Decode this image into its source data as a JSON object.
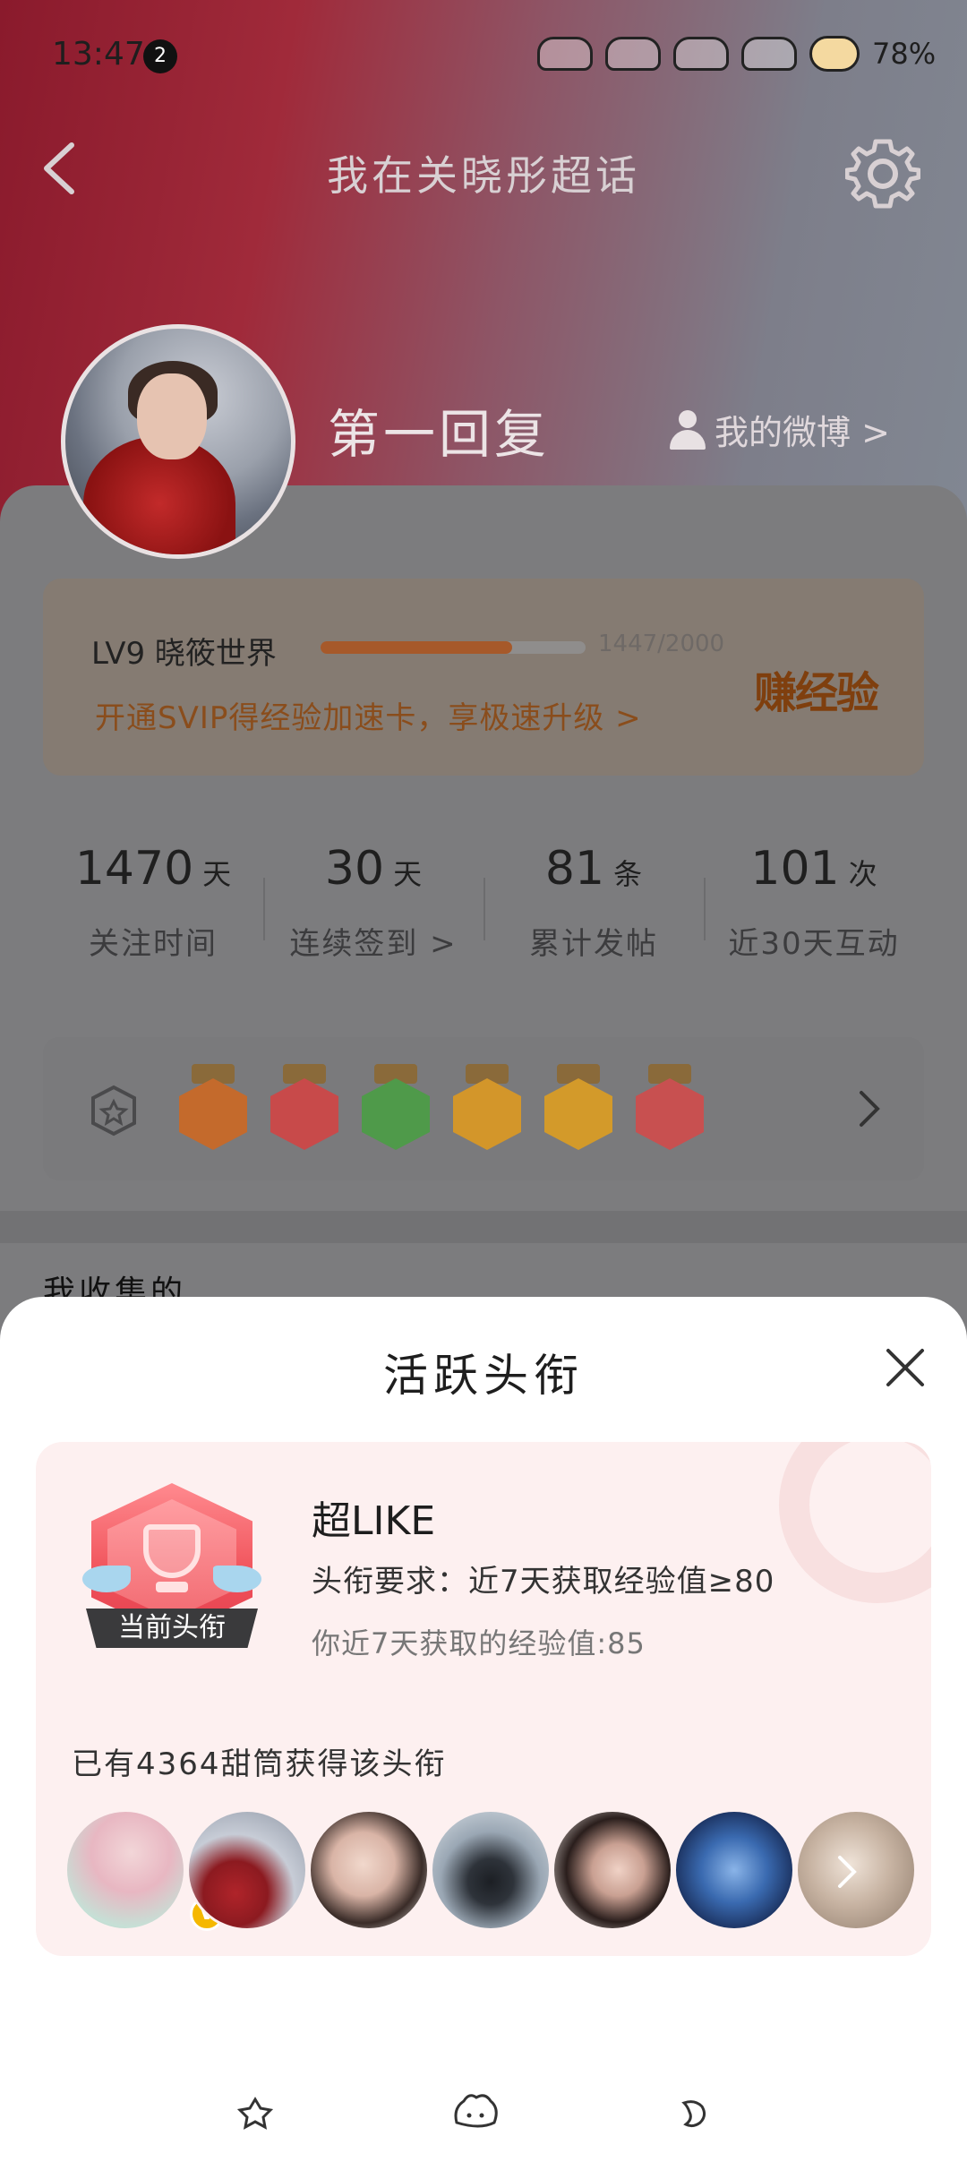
{
  "status_bar": {
    "time": "13:47",
    "notification_count": "2",
    "battery": "78%"
  },
  "nav": {
    "title": "我在关晓彤超话"
  },
  "profile": {
    "username": "第一回复",
    "my_weibo_label": "我的微博 >"
  },
  "level": {
    "label": "LV9 晓筱世界",
    "progress_text": "1447/2000",
    "progress_fraction": 0.7235,
    "promo": "开通SVIP得经验加速卡，享极速升级 >",
    "earn_label": "赚经验"
  },
  "stats": [
    {
      "value": "1470",
      "unit": "天",
      "label": "关注时间"
    },
    {
      "value": "30",
      "unit": "天",
      "label": "连续签到 >"
    },
    {
      "value": "81",
      "unit": "条",
      "label": "累计发帖"
    },
    {
      "value": "101",
      "unit": "次",
      "label": "近30天互动"
    }
  ],
  "badges": [
    {
      "icon": "lv-badge-icon",
      "color": "#c46a2c"
    },
    {
      "icon": "trophy-badge-icon",
      "color": "#c84a4a"
    },
    {
      "icon": "hand-badge-icon",
      "color": "#4f9a4a"
    },
    {
      "icon": "30-days-badge-icon",
      "color": "#d3962a"
    },
    {
      "icon": "laugh-badge-icon",
      "color": "#d39a2a"
    },
    {
      "icon": "rock-hand-badge-icon",
      "color": "#c85050"
    }
  ],
  "collect_label": "我收集的",
  "sheet": {
    "title": "活跃头衔",
    "badge_tag": "当前头衔",
    "title_name": "超LIKE",
    "requirement": "头衔要求：近7天获取经验值≥80",
    "my_value": "你近7天获取的经验值:85",
    "holder_count": "已有4364甜筒获得该头衔",
    "verified_mark": "V"
  },
  "colors": {
    "accent_orange": "#e07a2e",
    "title_red": "#f0525a",
    "card_pink": "#fdf0f0",
    "verified_yellow": "#f5b800"
  }
}
